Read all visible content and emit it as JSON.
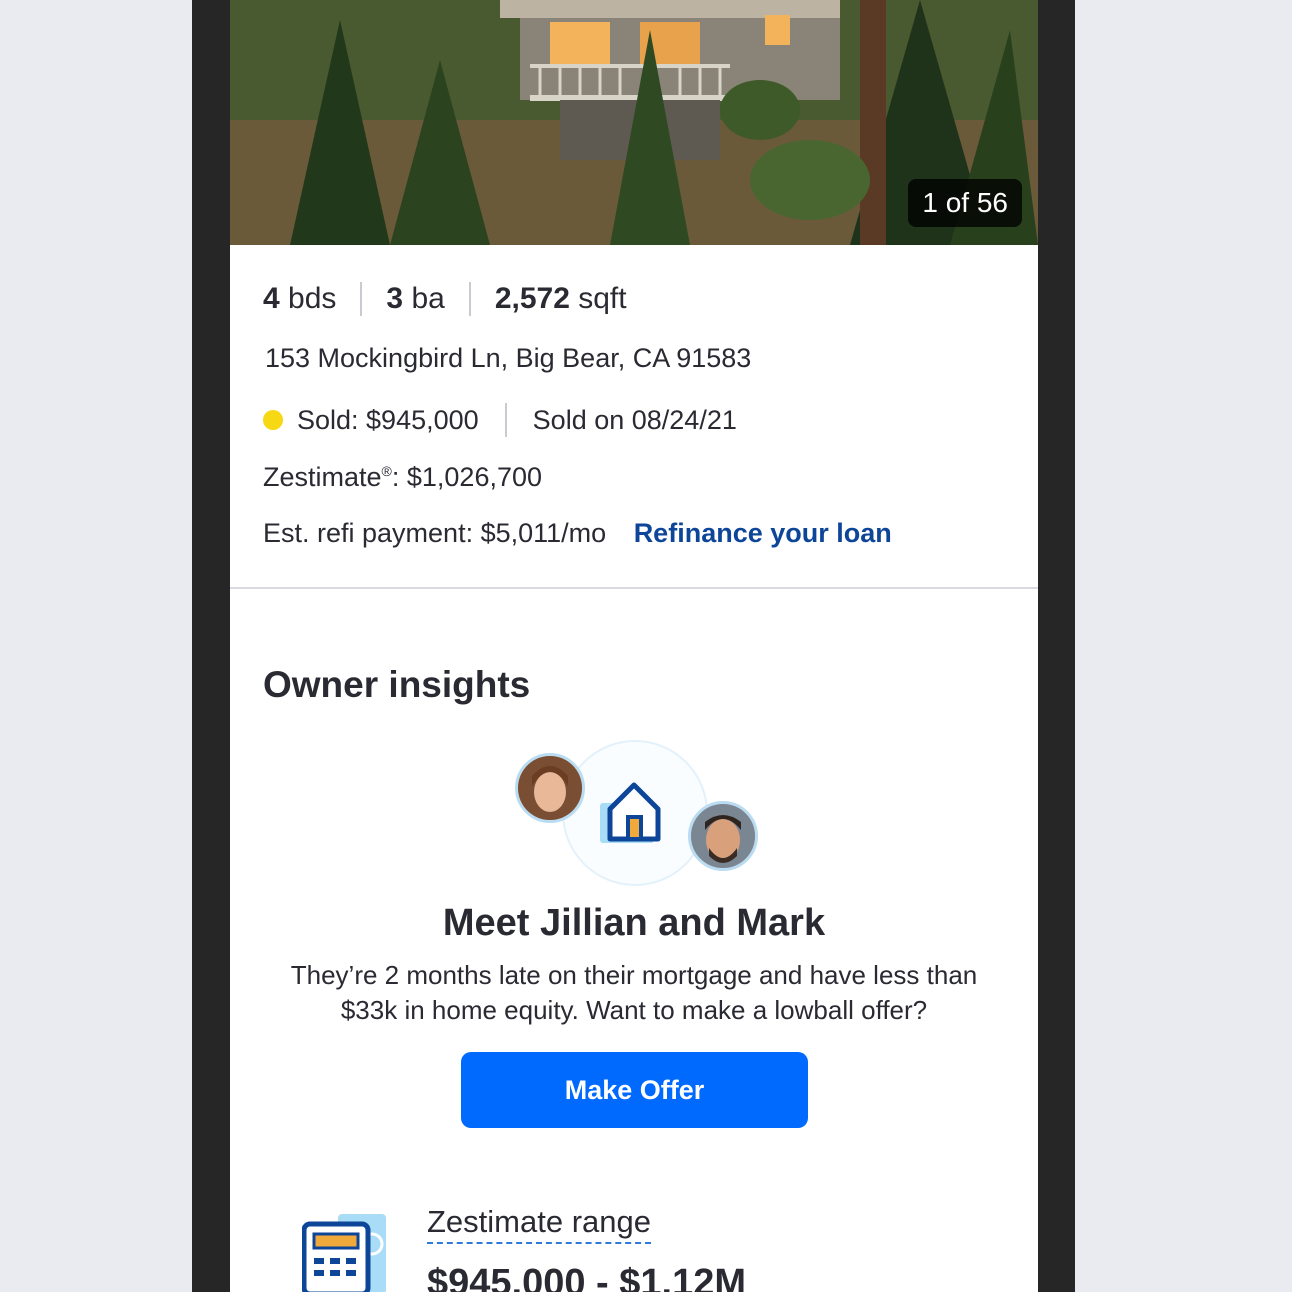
{
  "photo": {
    "counter": "1 of 56"
  },
  "facts": {
    "beds_num": "4",
    "beds_unit": "bds",
    "baths_num": "3",
    "baths_unit": "ba",
    "sqft_num": "2,572",
    "sqft_unit": "sqft"
  },
  "address": "153 Mockingbird Ln, Big Bear, CA 91583",
  "status": {
    "sold_text": "Sold: $945,000",
    "sold_on": "Sold on 08/24/21",
    "dot_color": "#f6d813"
  },
  "zestimate": {
    "label": "Zestimate",
    "reg": "®",
    "value": ": $1,026,700"
  },
  "refi": {
    "text": "Est. refi payment: $5,011/mo",
    "link": "Refinance your loan"
  },
  "insights": {
    "title": "Owner insights",
    "heading": "Meet Jillian and Mark",
    "description": "They’re 2 months late on their mortgage and have less than $33k in home equity. Want to make a lowball offer?",
    "button": "Make Offer"
  },
  "range": {
    "label": "Zestimate range",
    "value": "$945,000 - $1.12M"
  },
  "colors": {
    "accent": "#006aff",
    "link": "#0d4599"
  }
}
